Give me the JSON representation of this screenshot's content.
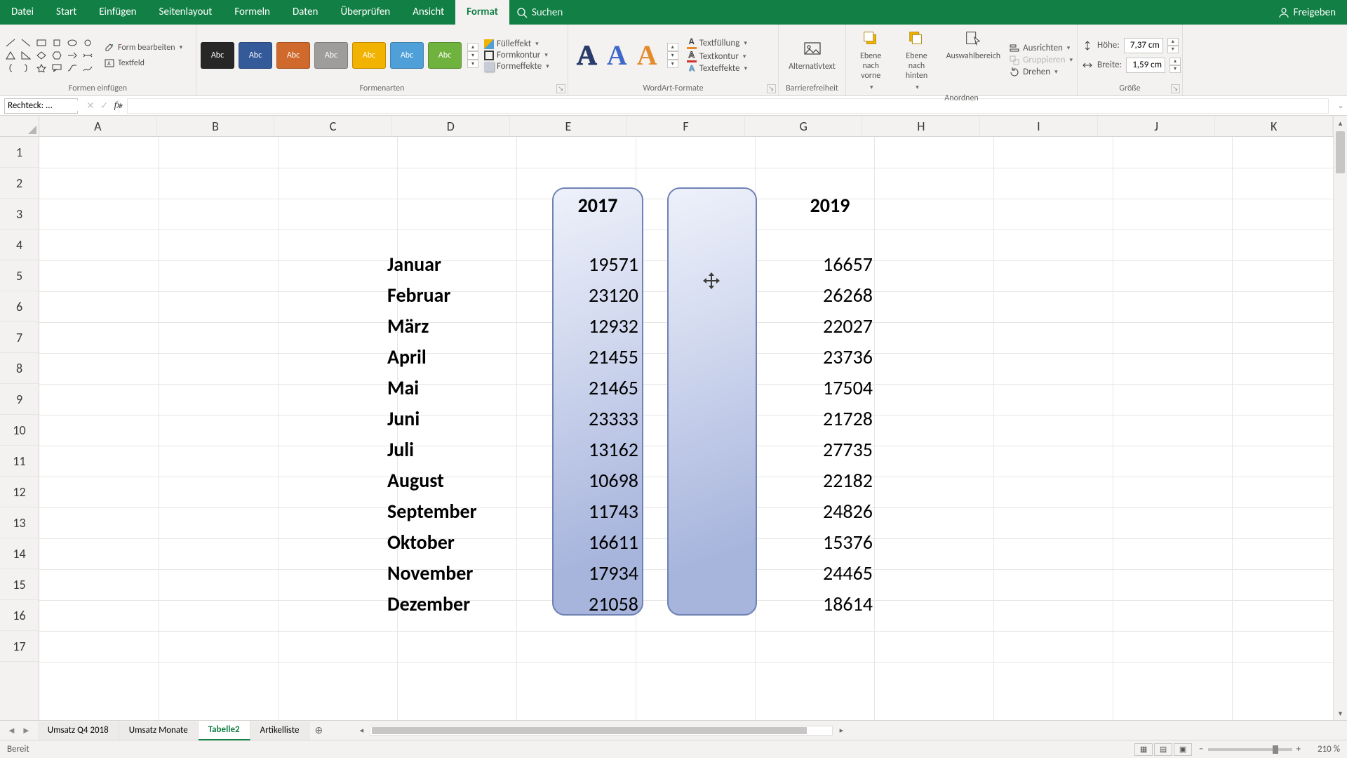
{
  "menu": {
    "tabs": [
      "Datei",
      "Start",
      "Einfügen",
      "Seitenlayout",
      "Formeln",
      "Daten",
      "Überprüfen",
      "Ansicht",
      "Format"
    ],
    "active_index": 8,
    "search_placeholder": "Suchen",
    "share": "Freigeben"
  },
  "ribbon": {
    "insert_shapes": {
      "label": "Formen einfügen",
      "edit_shape": "Form bearbeiten",
      "text_box": "Textfeld"
    },
    "shape_styles": {
      "label": "Formenarten",
      "swatch_text": "Abc",
      "fill_effect": "Fülleffekt",
      "shape_outline": "Formkontur",
      "shape_effects": "Formeffekte"
    },
    "wordart": {
      "label": "WordArt-Formate",
      "text_fill": "Textfüllung",
      "text_outline": "Textkontur",
      "text_effects": "Texteffekte"
    },
    "accessibility": {
      "label": "Barrierefreiheit",
      "alt_text": "Alternativtext"
    },
    "arrange": {
      "label": "Anordnen",
      "bring_forward": "Ebene nach vorne",
      "send_backward": "Ebene nach hinten",
      "selection_pane": "Auswahlbereich",
      "align": "Ausrichten",
      "group": "Gruppieren",
      "rotate": "Drehen"
    },
    "size": {
      "label": "Größe",
      "height_label": "Höhe:",
      "width_label": "Breite:",
      "height_value": "7,37 cm",
      "width_value": "1,59 cm"
    }
  },
  "formula_bar": {
    "name_box": "Rechteck: ..."
  },
  "grid": {
    "columns": [
      "A",
      "B",
      "C",
      "D",
      "E",
      "F",
      "G",
      "H",
      "I",
      "J",
      "K"
    ],
    "rows": [
      "1",
      "2",
      "3",
      "4",
      "5",
      "6",
      "7",
      "8",
      "9",
      "10",
      "11",
      "12",
      "13",
      "14",
      "15",
      "16",
      "17"
    ],
    "headers": {
      "y2017": "2017",
      "y2019": "2019"
    },
    "months": [
      "Januar",
      "Februar",
      "März",
      "April",
      "Mai",
      "Juni",
      "Juli",
      "August",
      "September",
      "Oktober",
      "November",
      "Dezember"
    ],
    "values_2017": [
      "19571",
      "23120",
      "12932",
      "21455",
      "21465",
      "23333",
      "13162",
      "10698",
      "11743",
      "16611",
      "17934",
      "21058"
    ],
    "values_2019": [
      "16657",
      "26268",
      "22027",
      "23736",
      "17504",
      "21728",
      "27735",
      "22182",
      "24826",
      "15376",
      "24465",
      "18614"
    ]
  },
  "sheets": {
    "nav_prev": "◄",
    "nav_next": "►",
    "tabs": [
      "Umsatz Q4 2018",
      "Umsatz Monate",
      "Tabelle2",
      "Artikelliste"
    ],
    "active_index": 2
  },
  "status": {
    "ready": "Bereit",
    "zoom": "210 %"
  }
}
